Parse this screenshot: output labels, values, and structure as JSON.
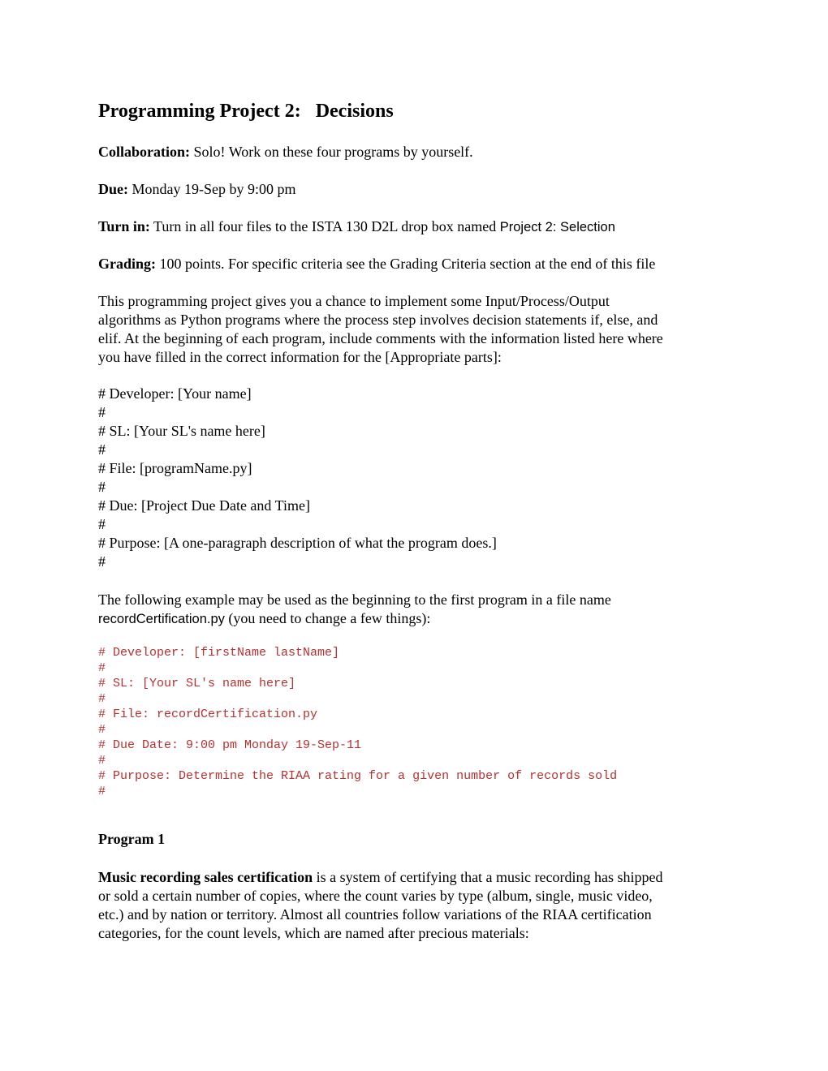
{
  "title": "Programming Project 2:   Decisions",
  "fields": {
    "collaboration": {
      "label": "Collaboration:",
      "value": " Solo! Work on these four programs by yourself."
    },
    "due": {
      "label": "Due:",
      "value": " Monday 19-Sep by 9:00 pm"
    },
    "turn_in": {
      "label": "Turn in:",
      "value": " Turn in all four files to the ISTA 130 D2L drop box named ",
      "dropbox_name": "Project 2: Selection"
    },
    "grading": {
      "label": "Grading:",
      "value": " 100 points. For specific criteria see the Grading Criteria section at the end of this file"
    }
  },
  "intro_lines": [
    "This programming project gives you a chance to implement some Input/Process/Output",
    "algorithms as Python programs where the process step involves decision statements if, else, and",
    "elif. At the beginning of each program, include comments with the information listed here where",
    "you have filled in the correct information for the [Appropriate parts]:"
  ],
  "template_comments": [
    "# Developer: [Your name]",
    "#",
    "# SL: [Your SL's name here]",
    "#",
    "# File: [programName.py]",
    "#",
    "# Due: [Project Due Date and Time]",
    "#",
    "# Purpose: [A one-paragraph description of what the program does.]",
    "#"
  ],
  "example_intro": {
    "line1": "The following example may be used as the beginning to the first program in a file name",
    "filename": "recordCertification.py",
    "line2_rest": " (you need to change a few things):"
  },
  "example_code": [
    "# Developer: [firstName lastName]",
    "#",
    "# SL: [Your SL's name here]",
    "#",
    "# File: recordCertification.py",
    "#",
    "# Due Date: 9:00 pm Monday 19-Sep-11",
    "#",
    "# Purpose: Determine the RIAA rating for a given number of records sold",
    "#"
  ],
  "program1": {
    "heading": "Program 1",
    "bold_term": "Music recording sales certification",
    "line1_rest": " is a system of certifying that a music recording has shipped",
    "lines": [
      "or sold a certain number of copies, where the count varies by type (album, single, music video,",
      "etc.) and by nation or territory. Almost all countries follow variations of the RIAA certification",
      "categories, for the count levels, which are named after precious materials:"
    ]
  },
  "colors": {
    "code_text": "#b83030"
  }
}
